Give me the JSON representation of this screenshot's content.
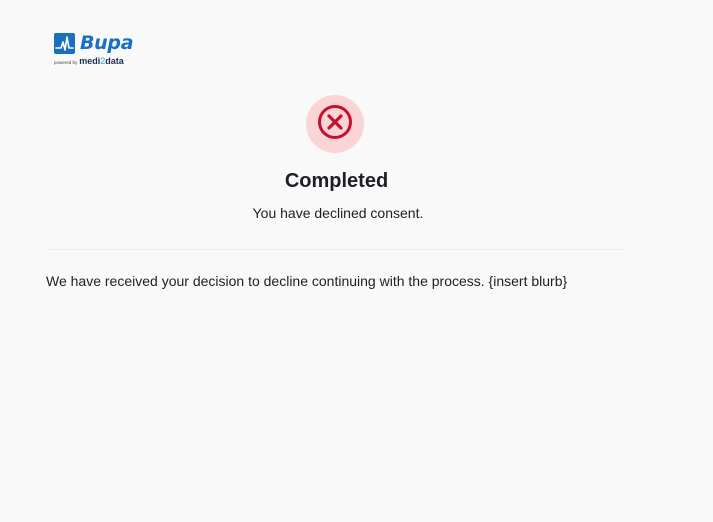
{
  "brand": {
    "name": "Bupa",
    "powered_by_prefix": "powered by",
    "powered_by_name_a": "medi",
    "powered_by_num": "2",
    "powered_by_name_b": "data",
    "color": "#1a6fc1"
  },
  "status": {
    "icon": "x-circle-icon",
    "icon_color": "#c8102e",
    "circle_bg": "#fbd5d6",
    "title": "Completed",
    "subtitle": "You have declined consent."
  },
  "message": {
    "text": "We have received your decision to decline continuing with the process. {insert blurb}"
  }
}
